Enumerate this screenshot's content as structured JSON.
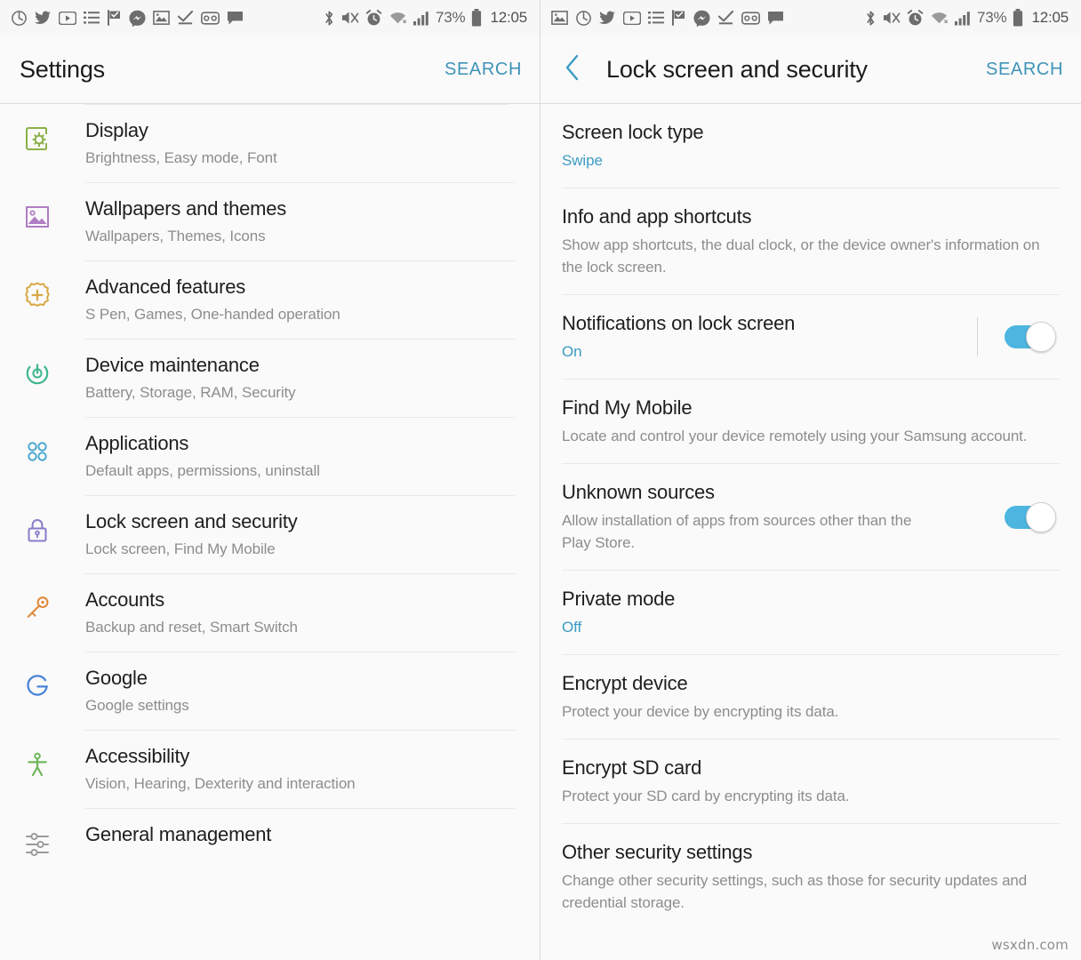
{
  "status_bar": {
    "left_panel_notification_icons": [
      "power-clock-icon",
      "twitter-icon",
      "youtube-icon",
      "list-icon",
      "flag-check-icon",
      "messenger-icon",
      "photo-icon",
      "check-underline-icon",
      "gear-vr-icon",
      "chat-bubble-icon"
    ],
    "right_panel_notification_icons": [
      "photo-icon",
      "power-clock-icon",
      "twitter-icon",
      "youtube-icon",
      "list-icon",
      "flag-check-icon",
      "messenger-icon",
      "check-underline-icon",
      "gear-vr-icon",
      "chat-bubble-icon"
    ],
    "system_icons": [
      "bluetooth-icon",
      "mute-icon",
      "alarm-icon",
      "wifi-icon",
      "signal-icon"
    ],
    "battery_percent": "73%",
    "clock": "12:05"
  },
  "left_panel": {
    "title": "Settings",
    "search_label": "SEARCH",
    "items": [
      {
        "title": "Display",
        "subtitle": "Brightness, Easy mode, Font",
        "icon": "display-icon",
        "color": "#8cb04a"
      },
      {
        "title": "Wallpapers and themes",
        "subtitle": "Wallpapers, Themes, Icons",
        "icon": "wallpaper-icon",
        "color": "#b07ec4"
      },
      {
        "title": "Advanced features",
        "subtitle": "S Pen, Games, One-handed operation",
        "icon": "advanced-gear-icon",
        "color": "#d9a843"
      },
      {
        "title": "Device maintenance",
        "subtitle": "Battery, Storage, RAM, Security",
        "icon": "maintenance-icon",
        "color": "#3fb68e"
      },
      {
        "title": "Applications",
        "subtitle": "Default apps, permissions, uninstall",
        "icon": "applications-icon",
        "color": "#4aa8cf"
      },
      {
        "title": "Lock screen and security",
        "subtitle": "Lock screen, Find My Mobile",
        "icon": "lock-icon",
        "color": "#8a7bc8"
      },
      {
        "title": "Accounts",
        "subtitle": "Backup and reset, Smart Switch",
        "icon": "key-icon",
        "color": "#e08a3c"
      },
      {
        "title": "Google",
        "subtitle": "Google settings",
        "icon": "google-icon",
        "color": "#4a84d8"
      },
      {
        "title": "Accessibility",
        "subtitle": "Vision, Hearing, Dexterity and interaction",
        "icon": "accessibility-icon",
        "color": "#6fb65a"
      },
      {
        "title": "General management",
        "subtitle": "",
        "icon": "sliders-icon",
        "color": "#9a9a9a"
      }
    ]
  },
  "right_panel": {
    "title": "Lock screen and security",
    "search_label": "SEARCH",
    "back_icon": "chevron-left-icon",
    "items": [
      {
        "title": "Screen lock type",
        "subtitle": "Swipe",
        "subtitle_accent": true,
        "toggle": null
      },
      {
        "title": "Info and app shortcuts",
        "subtitle": "Show app shortcuts, the dual clock, or the device owner's information on the lock screen.",
        "subtitle_accent": false,
        "toggle": null
      },
      {
        "title": "Notifications on lock screen",
        "subtitle": "On",
        "subtitle_accent": true,
        "toggle": "on",
        "toggle_divider": true
      },
      {
        "title": "Find My Mobile",
        "subtitle": "Locate and control your device remotely using your Samsung account.",
        "subtitle_accent": false,
        "toggle": null
      },
      {
        "title": "Unknown sources",
        "subtitle": "Allow installation of apps from sources other than the Play Store.",
        "subtitle_accent": false,
        "toggle": "on",
        "toggle_divider": false
      },
      {
        "title": "Private mode",
        "subtitle": "Off",
        "subtitle_accent": true,
        "toggle": null
      },
      {
        "title": "Encrypt device",
        "subtitle": "Protect your device by encrypting its data.",
        "subtitle_accent": false,
        "toggle": null
      },
      {
        "title": "Encrypt SD card",
        "subtitle": "Protect your SD card by encrypting its data.",
        "subtitle_accent": false,
        "toggle": null
      },
      {
        "title": "Other security settings",
        "subtitle": "Change other security settings, such as those for security updates and credential storage.",
        "subtitle_accent": false,
        "toggle": null
      }
    ]
  },
  "watermark": "wsxdn.com",
  "colors": {
    "accent": "#3b9bc4",
    "toggle_on": "#4cb5e0",
    "background": "#fafafa",
    "divider": "#e9e9e9",
    "title_text": "#1e1e1e",
    "subtitle_text": "#8d8d8d"
  }
}
